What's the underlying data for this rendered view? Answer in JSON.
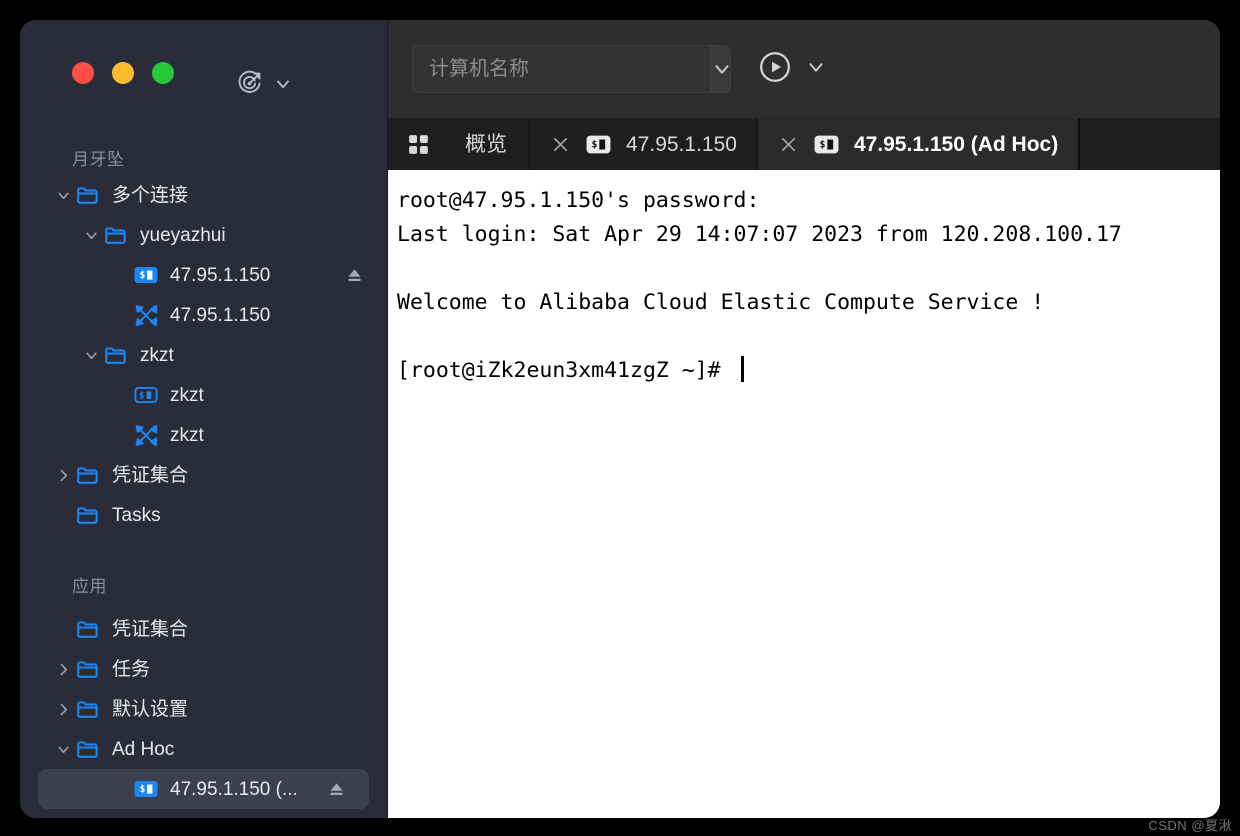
{
  "window": {
    "traffic_lights": [
      {
        "name": "close",
        "color": "#ff4e44"
      },
      {
        "name": "minimize",
        "color": "#ffbd2e"
      },
      {
        "name": "maximize",
        "color": "#28c83c"
      }
    ]
  },
  "sidebar": {
    "tools": {
      "target_icon": "target-icon",
      "chevron_icon": "chevron-down-icon"
    },
    "sections": [
      {
        "label": "月牙坠",
        "items": [
          {
            "label": "多个连接",
            "icon": "folder-icon",
            "indent": 0,
            "chevron": "down",
            "selected": false,
            "eject": false
          },
          {
            "label": "yueyazhui",
            "icon": "folder-icon",
            "indent": 1,
            "chevron": "down",
            "selected": false,
            "eject": false
          },
          {
            "label": "47.95.1.150",
            "icon": "terminal-filled-icon",
            "indent": 2,
            "chevron": "none",
            "selected": false,
            "eject": true
          },
          {
            "label": "47.95.1.150",
            "icon": "sftp-icon",
            "indent": 2,
            "chevron": "none",
            "selected": false,
            "eject": false
          },
          {
            "label": "zkzt",
            "icon": "folder-icon",
            "indent": 1,
            "chevron": "down",
            "selected": false,
            "eject": false
          },
          {
            "label": "zkzt",
            "icon": "terminal-outline-icon",
            "indent": 2,
            "chevron": "none",
            "selected": false,
            "eject": false
          },
          {
            "label": "zkzt",
            "icon": "sftp-icon",
            "indent": 2,
            "chevron": "none",
            "selected": false,
            "eject": false
          },
          {
            "label": "凭证集合",
            "icon": "folder-icon",
            "indent": 0,
            "chevron": "right",
            "selected": false,
            "eject": false
          },
          {
            "label": "Tasks",
            "icon": "folder-icon",
            "indent": 0,
            "chevron": "none",
            "selected": false,
            "eject": false
          }
        ]
      },
      {
        "label": "应用",
        "items": [
          {
            "label": "凭证集合",
            "icon": "folder-icon",
            "indent": 0,
            "chevron": "none",
            "selected": false,
            "eject": false
          },
          {
            "label": "任务",
            "icon": "folder-icon",
            "indent": 0,
            "chevron": "right",
            "selected": false,
            "eject": false
          },
          {
            "label": "默认设置",
            "icon": "folder-icon",
            "indent": 0,
            "chevron": "right",
            "selected": false,
            "eject": false
          },
          {
            "label": "Ad Hoc",
            "icon": "folder-icon",
            "indent": 0,
            "chevron": "down",
            "selected": false,
            "eject": false
          },
          {
            "label": "47.95.1.150 (...",
            "icon": "terminal-filled-icon",
            "indent": 2,
            "chevron": "none",
            "selected": true,
            "eject": true
          }
        ]
      }
    ]
  },
  "toolbar": {
    "search_placeholder": "计算机名称",
    "search_value": "",
    "dropdown_icon": "chevron-down-icon",
    "run_icon": "play-circle-icon",
    "run_dropdown_icon": "chevron-down-icon"
  },
  "tabs": [
    {
      "type": "overview",
      "label": "概览",
      "icon": "grid-icon",
      "closable": false,
      "active": false
    },
    {
      "type": "session",
      "label": "47.95.1.150",
      "icon": "terminal-filled-icon",
      "closable": true,
      "active": false
    },
    {
      "type": "session",
      "label": "47.95.1.150 (Ad Hoc)",
      "icon": "terminal-filled-icon",
      "closable": true,
      "active": true
    }
  ],
  "terminal": {
    "lines": [
      "root@47.95.1.150's password:",
      "Last login: Sat Apr 29 14:07:07 2023 from 120.208.100.17",
      "",
      "Welcome to Alibaba Cloud Elastic Compute Service !",
      "",
      "[root@iZk2eun3xm41zgZ ~]# "
    ],
    "prompt": "[root@iZk2eun3xm41zgZ ~]# "
  },
  "watermark": "CSDN @夏湫",
  "colors": {
    "sidebar_bg": "#2a2c39",
    "toolbar_bg": "#2e2e2e",
    "tabstrip_bg": "#1e1e1e",
    "accent_blue": "#1b87f5",
    "terminal_bg": "#ffffff",
    "selection_bg": "#3c3f4d"
  }
}
